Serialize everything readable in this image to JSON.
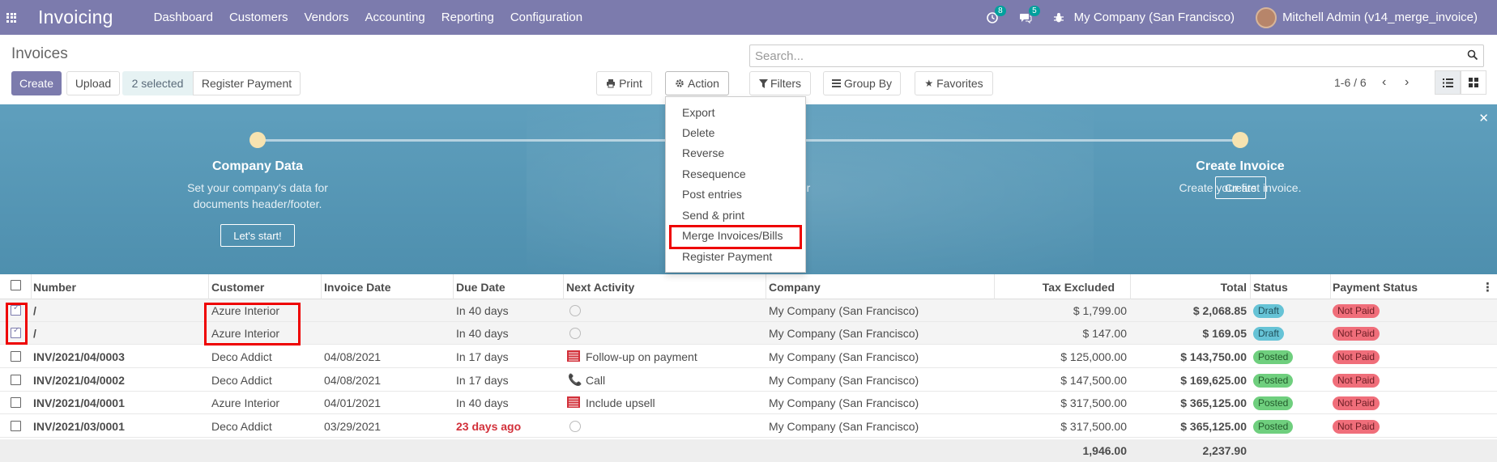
{
  "navbar": {
    "brand": "Invoicing",
    "menu": [
      "Dashboard",
      "Customers",
      "Vendors",
      "Accounting",
      "Reporting",
      "Configuration"
    ],
    "activity_count": "8",
    "messages_count": "5",
    "company": "My Company (San Francisco)",
    "user": "Mitchell Admin (v14_merge_invoice)"
  },
  "control": {
    "title": "Invoices",
    "create_label": "Create",
    "upload_label": "Upload",
    "selected_label": "2 selected",
    "register_payment_label": "Register Payment",
    "print_label": "Print",
    "action_label": "Action",
    "search_placeholder": "Search...",
    "filters_label": "Filters",
    "groupby_label": "Group By",
    "favorites_label": "Favorites",
    "pager": "1-6 / 6"
  },
  "action_menu": {
    "items": [
      "Export",
      "Delete",
      "Reverse",
      "Resequence",
      "Post entries",
      "Send & print",
      "Merge Invoices/Bills",
      "Register Payment"
    ]
  },
  "banner": {
    "step1": {
      "title": "Company Data",
      "desc1": "Set your company's data for",
      "desc2": "documents header/footer.",
      "button": "Let's start!"
    },
    "step2": {
      "partial": "our"
    },
    "step3": {
      "title": "Create Invoice",
      "desc": "Create your first invoice.",
      "button": "Create"
    }
  },
  "table": {
    "headers": [
      "Number",
      "Customer",
      "Invoice Date",
      "Due Date",
      "Next Activity",
      "Company",
      "Tax Excluded",
      "Total",
      "Status",
      "Payment Status"
    ],
    "rows": [
      {
        "number": "/",
        "customer": "Azure Interior",
        "invoice_date": "",
        "due_date": "In 40 days",
        "activity": "",
        "activity_icon": "clock-icon",
        "company": "My Company (San Francisco)",
        "tax_excluded": "$ 1,799.00",
        "total": "$ 2,068.85",
        "status": "Draft",
        "payment_status": "Not Paid",
        "checked": true
      },
      {
        "number": "/",
        "customer": "Azure Interior",
        "invoice_date": "",
        "due_date": "In 40 days",
        "activity": "",
        "activity_icon": "clock-icon",
        "company": "My Company (San Francisco)",
        "tax_excluded": "$ 147.00",
        "total": "$ 169.05",
        "status": "Draft",
        "payment_status": "Not Paid",
        "checked": true
      },
      {
        "number": "INV/2021/04/0003",
        "customer": "Deco Addict",
        "invoice_date": "04/08/2021",
        "due_date": "In 17 days",
        "activity": "Follow-up on payment",
        "activity_icon": "email-list-icon",
        "company": "My Company (San Francisco)",
        "tax_excluded": "$ 125,000.00",
        "total": "$ 143,750.00",
        "status": "Posted",
        "payment_status": "Not Paid",
        "checked": false
      },
      {
        "number": "INV/2021/04/0002",
        "customer": "Deco Addict",
        "invoice_date": "04/08/2021",
        "due_date": "In 17 days",
        "activity": "Call",
        "activity_icon": "phone-icon",
        "company": "My Company (San Francisco)",
        "tax_excluded": "$ 147,500.00",
        "total": "$ 169,625.00",
        "status": "Posted",
        "payment_status": "Not Paid",
        "checked": false
      },
      {
        "number": "INV/2021/04/0001",
        "customer": "Azure Interior",
        "invoice_date": "04/01/2021",
        "due_date": "In 40 days",
        "activity": "Include upsell",
        "activity_icon": "email-list-icon",
        "company": "My Company (San Francisco)",
        "tax_excluded": "$ 317,500.00",
        "total": "$ 365,125.00",
        "status": "Posted",
        "payment_status": "Not Paid",
        "checked": false
      },
      {
        "number": "INV/2021/03/0001",
        "customer": "Deco Addict",
        "invoice_date": "03/29/2021",
        "due_date": "23 days ago",
        "activity": "",
        "activity_icon": "clock-icon",
        "company": "My Company (San Francisco)",
        "tax_excluded": "$ 317,500.00",
        "total": "$ 365,125.00",
        "status": "Posted",
        "payment_status": "Not Paid",
        "checked": false
      }
    ],
    "totals": {
      "tax_excluded": "1,946.00",
      "total": "2,237.90"
    }
  },
  "colors": {
    "navbar": "#7c7bad",
    "banner": "#5f9fbd",
    "highlight": "#e00000"
  }
}
